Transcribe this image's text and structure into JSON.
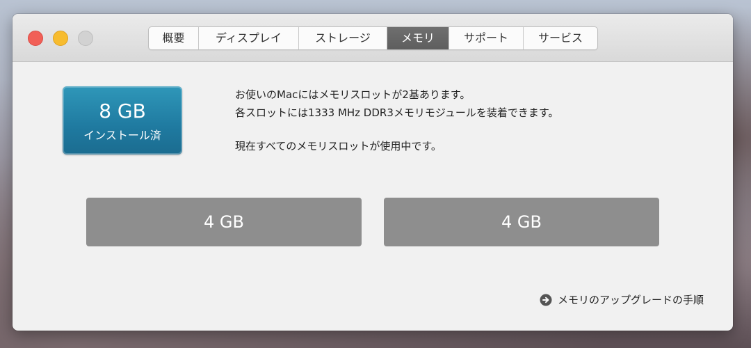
{
  "window": {
    "tabs": [
      {
        "label": "概要"
      },
      {
        "label": "ディスプレイ"
      },
      {
        "label": "ストレージ"
      },
      {
        "label": "メモリ"
      },
      {
        "label": "サポート"
      },
      {
        "label": "サービス"
      }
    ],
    "active_tab": "メモリ"
  },
  "memory": {
    "installed_size": "8 GB",
    "installed_label": "インストール済",
    "info_line1": "お使いのMacにはメモリスロットが2基あります。",
    "info_line2": "各スロットには1333 MHz DDR3メモリモジュールを装着できます。",
    "info_line3": "現在すべてのメモリスロットが使用中です。",
    "slots": [
      {
        "size": "4 GB"
      },
      {
        "size": "4 GB"
      }
    ],
    "upgrade_link": "メモリのアップグレードの手順"
  },
  "colors": {
    "badge": "#1f7aa0",
    "slot": "#8e8e8e",
    "active_tab": "#5e5e5e",
    "close": "#f15f57",
    "minimize": "#f7bc2f",
    "zoom": "#d2d2d2"
  },
  "icons": {
    "upgrade_link_icon": "arrow-circle-right-icon"
  }
}
